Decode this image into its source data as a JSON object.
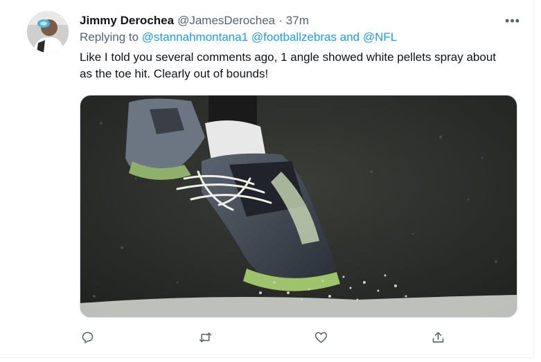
{
  "tweet": {
    "author_name": "Jimmy Derochea",
    "author_handle": "@JamesDerochea",
    "separator": "·",
    "time": "37m",
    "more_label": "•••",
    "replying_prefix": "Replying to",
    "reply_mentions": [
      "@stannahmontana1",
      "@footballzebras",
      "@NFL"
    ],
    "reply_and": "and",
    "text": "Like I told you several comments ago, 1 angle showed white pellets spray about as the toe hit. Clearly out of bounds!",
    "actions": [
      {
        "name": "reply",
        "icon": "comment-icon"
      },
      {
        "name": "retweet",
        "icon": "retweet-icon"
      },
      {
        "name": "like",
        "icon": "heart-icon"
      },
      {
        "name": "share",
        "icon": "share-icon"
      }
    ]
  },
  "colors": {
    "link": "#1d9bf0",
    "secondary_text": "#536471",
    "primary_text": "#0f1419"
  }
}
